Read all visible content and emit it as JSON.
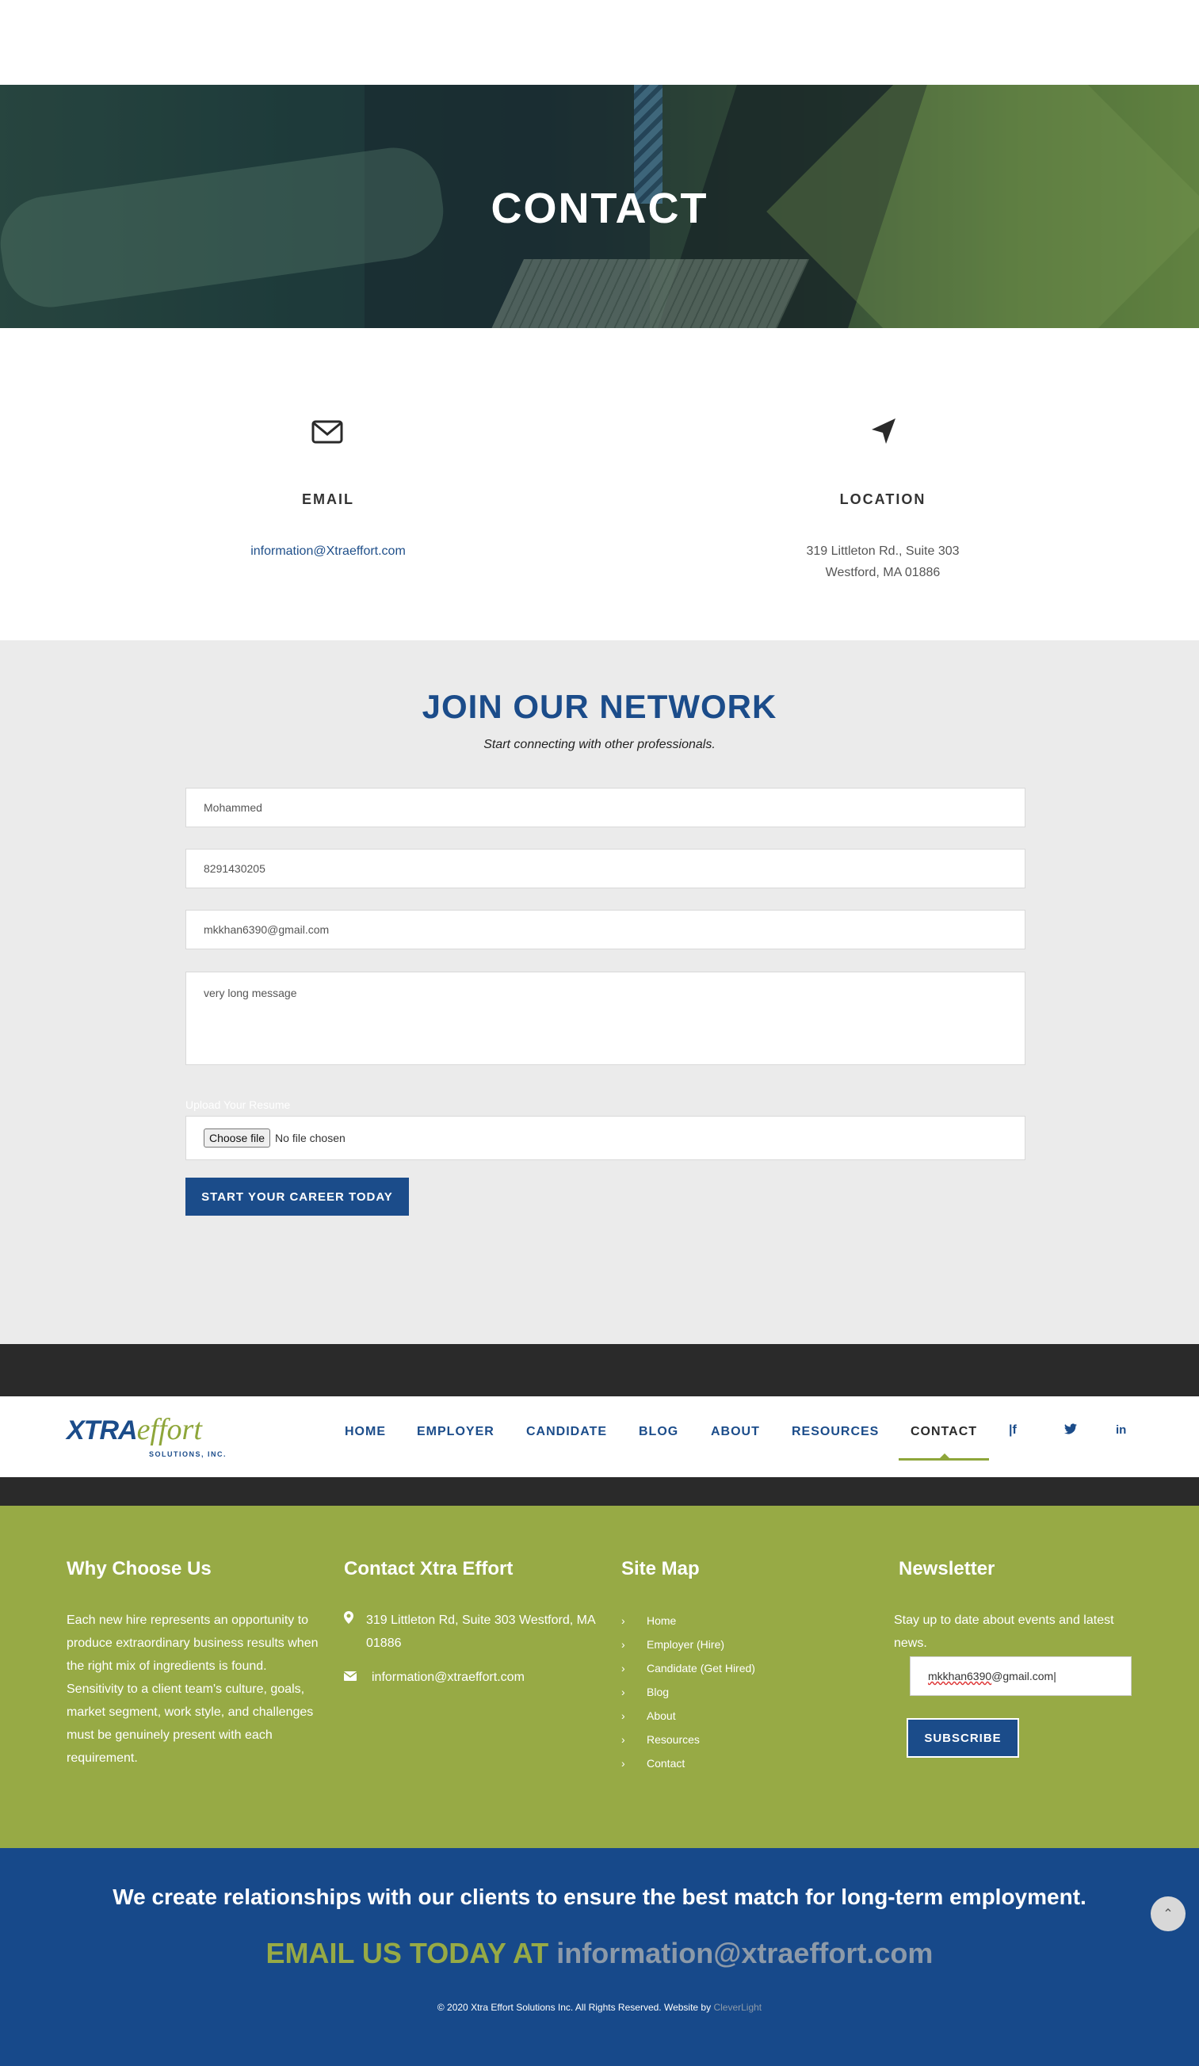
{
  "hero": {
    "title": "CONTACT"
  },
  "info": {
    "email": {
      "title": "EMAIL",
      "value": "information@Xtraeffort.com",
      "icon": "envelope-icon"
    },
    "location": {
      "title": "LOCATION",
      "line1": "319 Littleton Rd., Suite 303",
      "line2": "Westford, MA 01886",
      "icon": "location-arrow-icon"
    }
  },
  "join": {
    "heading": "JOIN OUR NETWORK",
    "subheading": "Start connecting with other professionals.",
    "fields": {
      "name": "Mohammed",
      "phone": "8291430205",
      "email": "mkkhan6390@gmail.com",
      "message": "very long message"
    },
    "upload_label": "Upload Your Resume",
    "file_button": "Choose file",
    "file_status": "No file chosen",
    "submit": "START YOUR CAREER TODAY"
  },
  "nav": {
    "logo": {
      "xtra": "XTRA",
      "effort": "effort",
      "inc": "SOLUTIONS, INC."
    },
    "items": [
      "HOME",
      "EMPLOYER",
      "CANDIDATE",
      "BLOG",
      "ABOUT",
      "RESOURCES",
      "CONTACT"
    ],
    "active": "CONTACT",
    "social": [
      "facebook-icon",
      "twitter-icon",
      "linkedin-icon"
    ]
  },
  "footer": {
    "why": {
      "title": "Why Choose Us",
      "text": "Each new hire represents an opportunity to produce extraordinary business results when the right mix of ingredients is found. Sensitivity to a client team's culture, goals, market segment, work style, and challenges must be genuinely present with each requirement."
    },
    "contact": {
      "title": "Contact Xtra Effort",
      "address": "319 Littleton Rd, Suite 303 Westford, MA 01886",
      "email": "information@xtraeffort.com"
    },
    "sitemap": {
      "title": "Site Map",
      "links": [
        "Home",
        "Employer (Hire)",
        "Candidate (Get Hired)",
        "Blog",
        "About",
        "Resources",
        "Contact"
      ]
    },
    "newsletter": {
      "title": "Newsletter",
      "text": "Stay up to date about events and latest news.",
      "input_part1": "mkkhan6390",
      "input_part2": "@gmail.com",
      "button": "SUBSCRIBE"
    }
  },
  "bottom": {
    "tagline": "We create relationships with our clients to ensure the best match for long-term employment.",
    "cta_prefix": "EMAIL US TODAY AT",
    "cta_email": "information@xtraeffort.com",
    "copyright": "© 2020 Xtra Effort Solutions Inc. All Rights Reserved. Website by",
    "credit": "CleverLight"
  },
  "colors": {
    "brand_blue": "#1b4c8a",
    "brand_green": "#97aa45",
    "dark": "#2a2a2a"
  }
}
